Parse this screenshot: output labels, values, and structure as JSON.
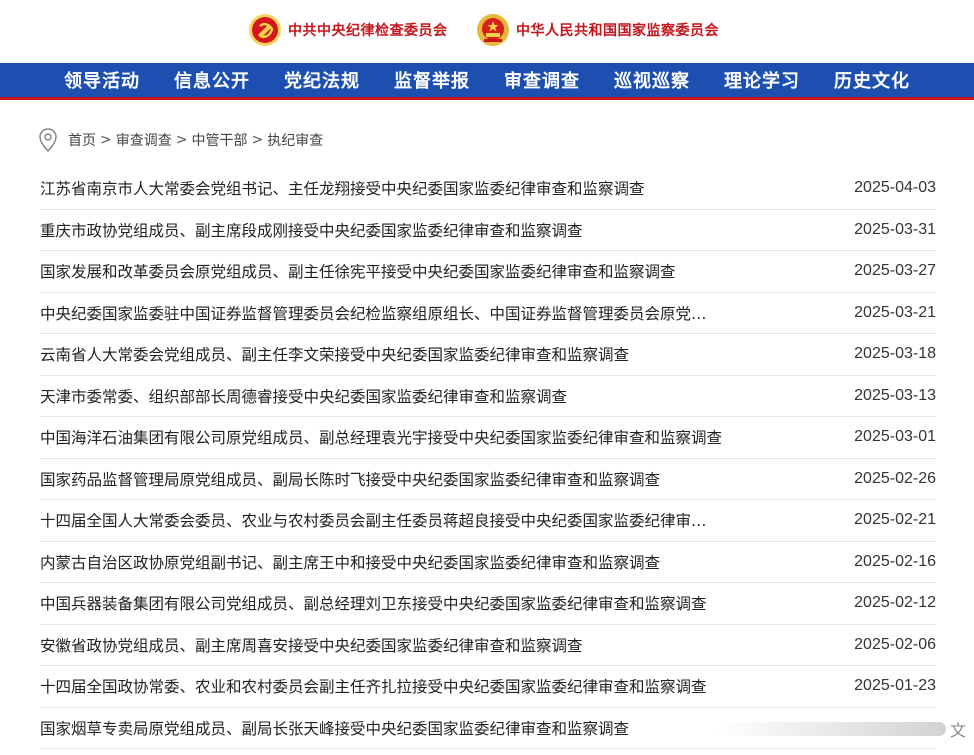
{
  "header": {
    "org_left": "中共中央纪律检查委员会",
    "org_right": "中华人民共和国国家监察委员会"
  },
  "nav": {
    "items": [
      "领导活动",
      "信息公开",
      "党纪法规",
      "监督举报",
      "审查调查",
      "巡视巡察",
      "理论学习",
      "历史文化"
    ]
  },
  "breadcrumb": {
    "items": [
      "首页",
      "审查调查",
      "中管干部",
      "执纪审查"
    ],
    "separator": ">"
  },
  "list": [
    {
      "title": "江苏省南京市人大常委会党组书记、主任龙翔接受中央纪委国家监委纪律审查和监察调查",
      "date": "2025-04-03"
    },
    {
      "title": "重庆市政协党组成员、副主席段成刚接受中央纪委国家监委纪律审查和监察调查",
      "date": "2025-03-31"
    },
    {
      "title": "国家发展和改革委员会原党组成员、副主任徐宪平接受中央纪委国家监委纪律审查和监察调查",
      "date": "2025-03-27"
    },
    {
      "title": "中央纪委国家监委驻中国证券监督管理委员会纪检监察组原组长、中国证券监督管理委员会原党…",
      "date": "2025-03-21"
    },
    {
      "title": "云南省人大常委会党组成员、副主任李文荣接受中央纪委国家监委纪律审查和监察调查",
      "date": "2025-03-18"
    },
    {
      "title": "天津市委常委、组织部部长周德睿接受中央纪委国家监委纪律审查和监察调查",
      "date": "2025-03-13"
    },
    {
      "title": "中国海洋石油集团有限公司原党组成员、副总经理袁光宇接受中央纪委国家监委纪律审查和监察调查",
      "date": "2025-03-01"
    },
    {
      "title": "国家药品监督管理局原党组成员、副局长陈时飞接受中央纪委国家监委纪律审查和监察调查",
      "date": "2025-02-26"
    },
    {
      "title": "十四届全国人大常委会委员、农业与农村委员会副主任委员蒋超良接受中央纪委国家监委纪律审…",
      "date": "2025-02-21"
    },
    {
      "title": "内蒙古自治区政协原党组副书记、副主席王中和接受中央纪委国家监委纪律审查和监察调查",
      "date": "2025-02-16"
    },
    {
      "title": "中国兵器装备集团有限公司党组成员、副总经理刘卫东接受中央纪委国家监委纪律审查和监察调查",
      "date": "2025-02-12"
    },
    {
      "title": "安徽省政协党组成员、副主席周喜安接受中央纪委国家监委纪律审查和监察调查",
      "date": "2025-02-06"
    },
    {
      "title": "十四届全国政协常委、农业和农村委员会副主任齐扎拉接受中央纪委国家监委纪律审查和监察调查",
      "date": "2025-01-23"
    },
    {
      "title": "国家烟草专卖局原党组成员、副局长张天峰接受中央纪委国家监委纪律审查和监察调查",
      "date": ""
    }
  ],
  "watermark": {
    "char": "文"
  },
  "colors": {
    "nav_bg": "#1d4fb1",
    "nav_border": "#c8161d",
    "org_red": "#c4161c"
  }
}
